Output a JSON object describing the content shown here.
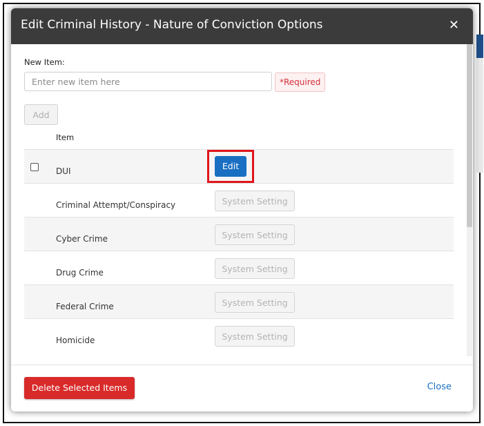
{
  "modal": {
    "title": "Edit Criminal History - Nature of Conviction Options",
    "close_icon": "close-icon",
    "close_glyph": "✕"
  },
  "form": {
    "new_item_label": "New Item:",
    "new_item_placeholder": "Enter new item here",
    "new_item_value": "",
    "required_text": "*Required",
    "add_label": "Add"
  },
  "table": {
    "column_header": "Item",
    "rows": [
      {
        "label": "DUI",
        "action": "Edit",
        "checkbox": true
      },
      {
        "label": "Criminal Attempt/Conspiracy",
        "action": "System Setting",
        "checkbox": false
      },
      {
        "label": "Cyber Crime",
        "action": "System Setting",
        "checkbox": false
      },
      {
        "label": "Drug Crime",
        "action": "System Setting",
        "checkbox": false
      },
      {
        "label": "Federal Crime",
        "action": "System Setting",
        "checkbox": false
      },
      {
        "label": "Homicide",
        "action": "System Setting",
        "checkbox": false
      }
    ]
  },
  "footer": {
    "delete_label": "Delete Selected Items",
    "close_label": "Close"
  },
  "colors": {
    "header_bg": "#3b3b3b",
    "primary": "#1a6fc2",
    "danger": "#d92a2a",
    "highlight": "#e0151b"
  }
}
